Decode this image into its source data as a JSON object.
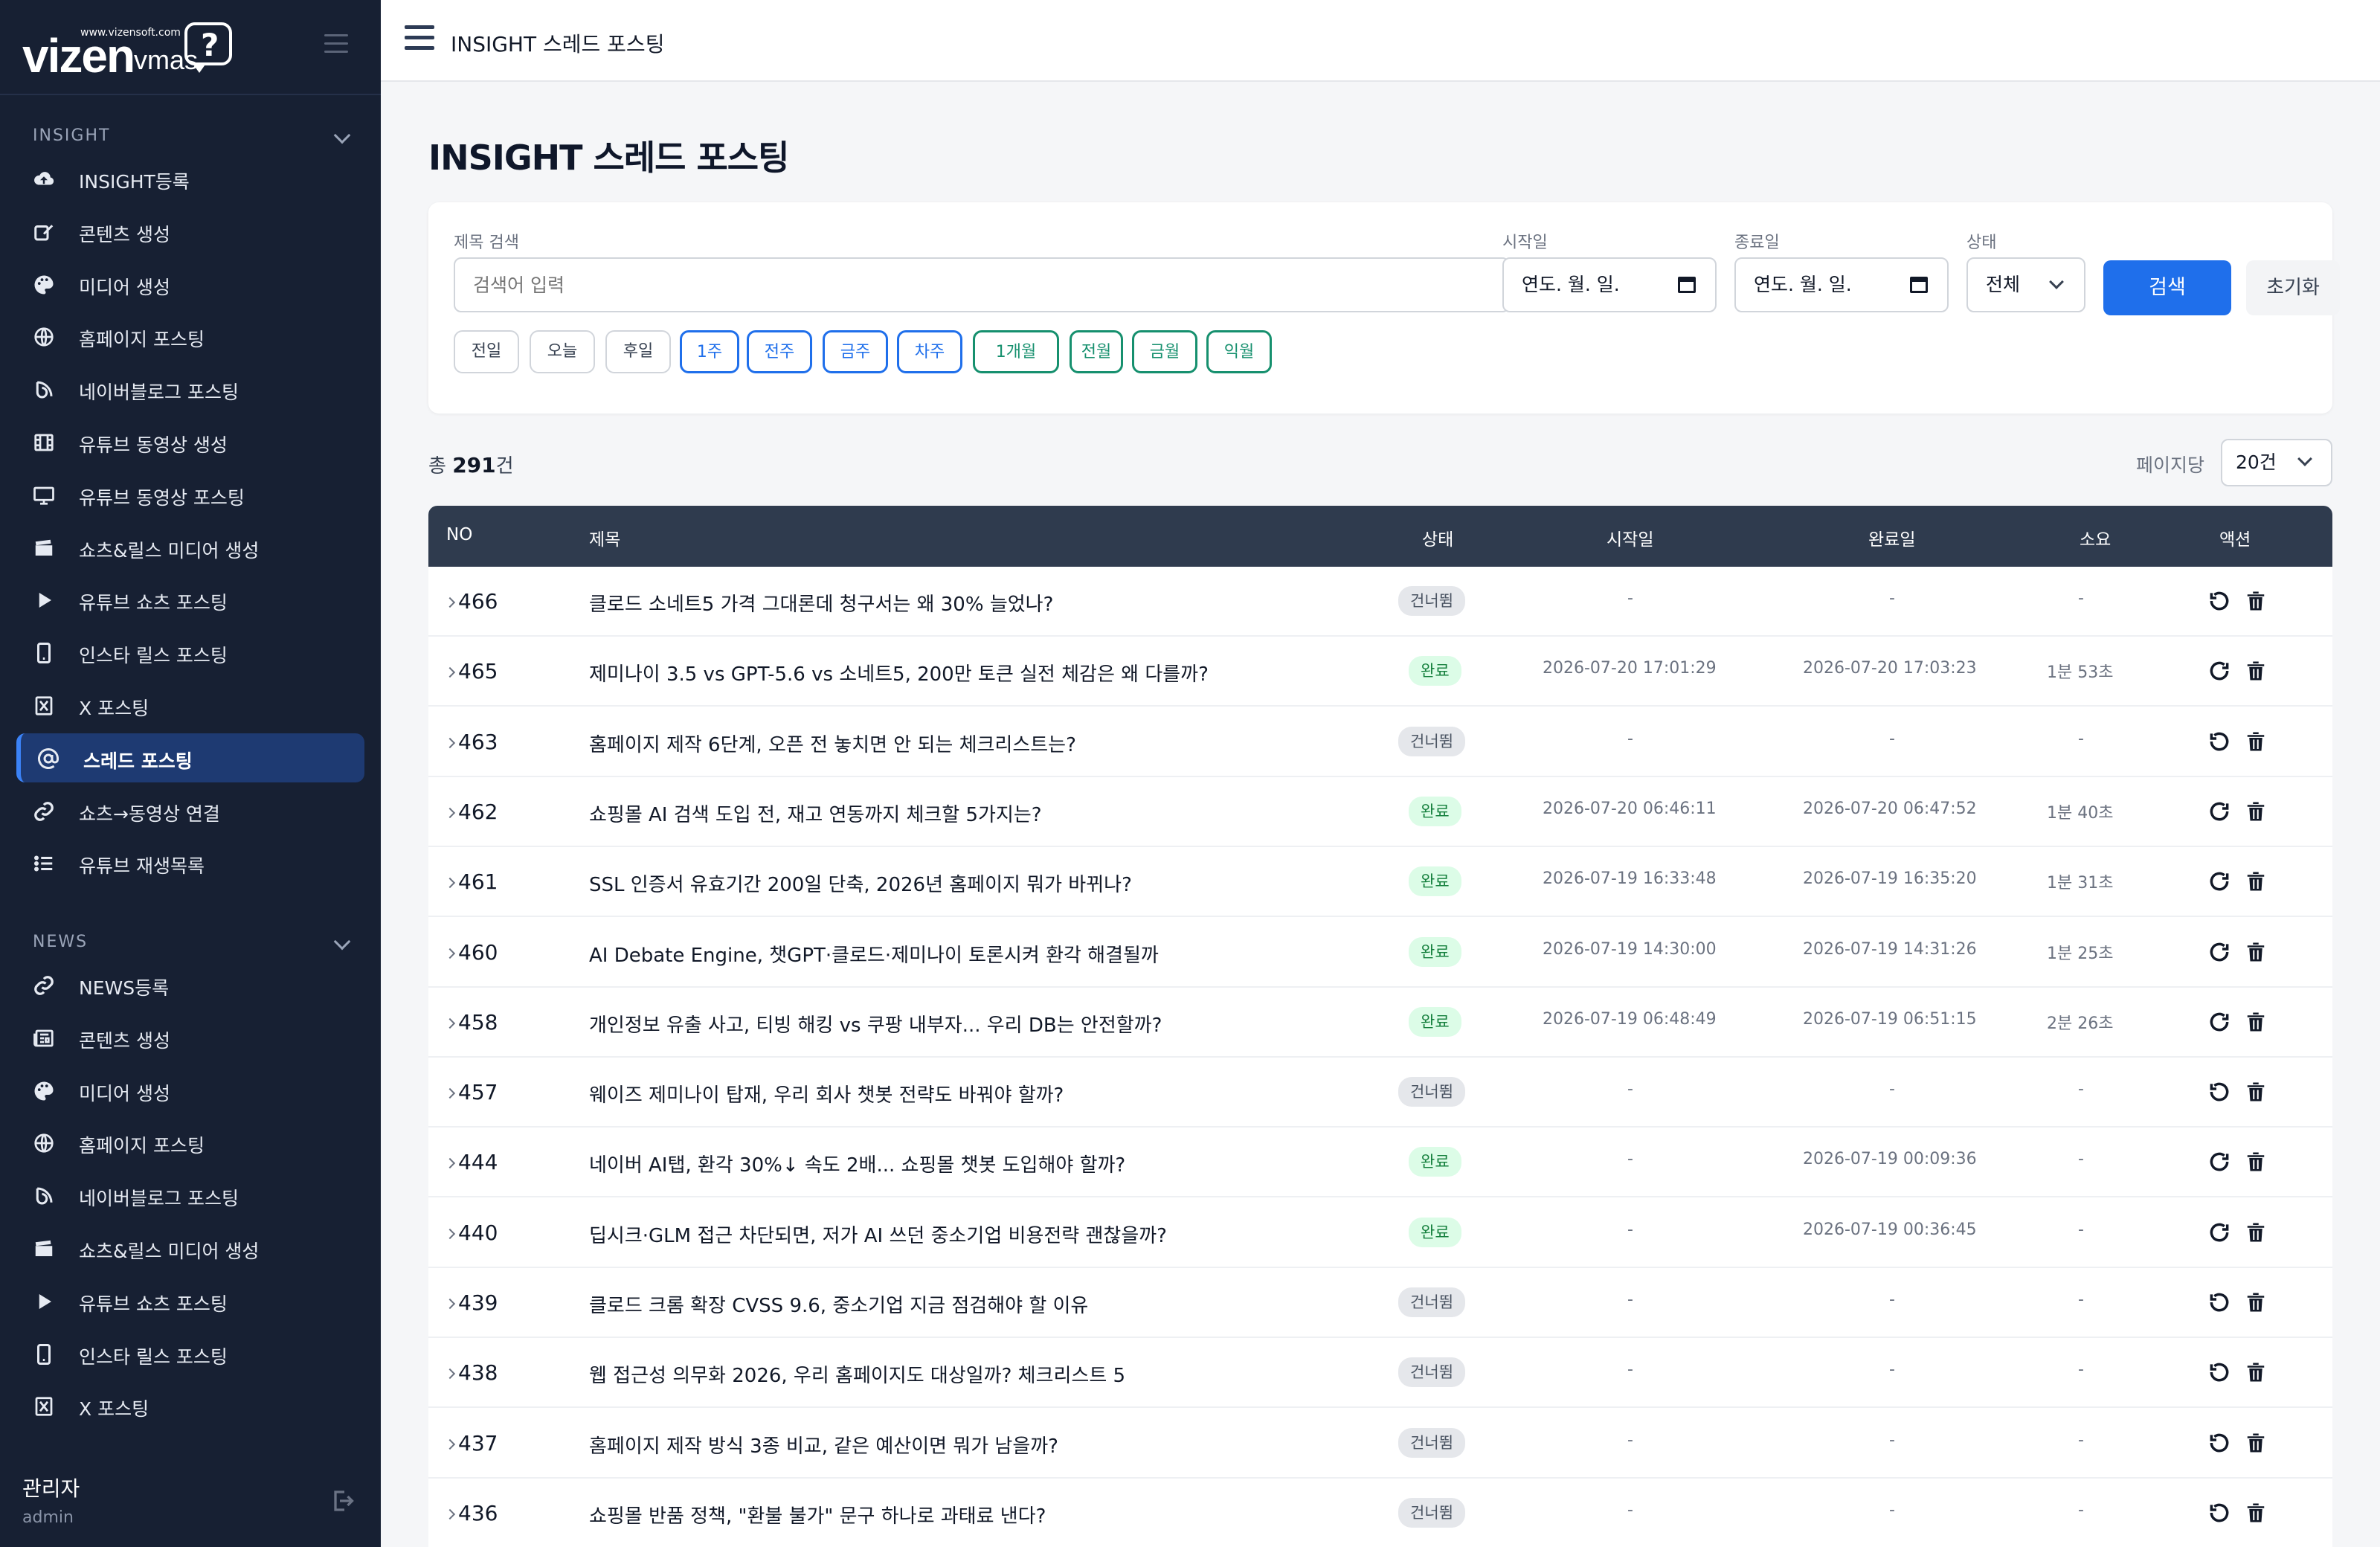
{
  "logo": {
    "url": "www.vizensoft.com",
    "vizen": "vizen",
    "vmas": "vmas",
    "bubble": "?"
  },
  "sidebar": {
    "sections": [
      {
        "title": "INSIGHT",
        "items": [
          {
            "label": "INSIGHT등록",
            "icon": "cloud-upload-icon"
          },
          {
            "label": "콘텐츠 생성",
            "icon": "edit-icon"
          },
          {
            "label": "미디어 생성",
            "icon": "palette-icon"
          },
          {
            "label": "홈페이지 포스팅",
            "icon": "globe-icon"
          },
          {
            "label": "네이버블로그 포스팅",
            "icon": "blog-icon"
          },
          {
            "label": "유튜브 동영상 생성",
            "icon": "film-icon"
          },
          {
            "label": "유튜브 동영상 포스팅",
            "icon": "monitor-icon"
          },
          {
            "label": "쇼츠&릴스 미디어 생성",
            "icon": "clapper-icon"
          },
          {
            "label": "유튜브 쇼츠 포스팅",
            "icon": "play-icon"
          },
          {
            "label": "인스타 릴스 포스팅",
            "icon": "phone-icon"
          },
          {
            "label": "X 포스팅",
            "icon": "x-icon"
          },
          {
            "label": "스레드 포스팅",
            "icon": "at-icon",
            "active": true
          },
          {
            "label": "쇼츠→동영상 연결",
            "icon": "link-icon"
          },
          {
            "label": "유튜브 재생목록",
            "icon": "list-icon"
          }
        ]
      },
      {
        "title": "NEWS",
        "items": [
          {
            "label": "NEWS등록",
            "icon": "link-icon"
          },
          {
            "label": "콘텐츠 생성",
            "icon": "newspaper-icon"
          },
          {
            "label": "미디어 생성",
            "icon": "palette-icon"
          },
          {
            "label": "홈페이지 포스팅",
            "icon": "globe-icon"
          },
          {
            "label": "네이버블로그 포스팅",
            "icon": "blog-icon"
          },
          {
            "label": "쇼츠&릴스 미디어 생성",
            "icon": "clapper-icon"
          },
          {
            "label": "유튜브 쇼츠 포스팅",
            "icon": "play-icon"
          },
          {
            "label": "인스타 릴스 포스팅",
            "icon": "phone-icon"
          },
          {
            "label": "X 포스팅",
            "icon": "x-icon"
          }
        ]
      }
    ],
    "user": {
      "name": "관리자",
      "id": "admin"
    }
  },
  "topbar": {
    "title": "INSIGHT 스레드 포스팅"
  },
  "page": {
    "title": "INSIGHT 스레드 포스팅"
  },
  "filter": {
    "title_label": "제목 검색",
    "title_placeholder": "검색어 입력",
    "start_label": "시작일",
    "start_value": "연도. 월. 일.",
    "end_label": "종료일",
    "end_value": "연도. 월. 일.",
    "status_label": "상태",
    "status_value": "전체",
    "search_btn": "검색",
    "reset_btn": "초기화",
    "quick": [
      {
        "label": "전일",
        "style": "gray"
      },
      {
        "label": "오늘",
        "style": "gray"
      },
      {
        "label": "후일",
        "style": "gray"
      },
      {
        "label": "1주",
        "style": "blue"
      },
      {
        "label": "전주",
        "style": "blue"
      },
      {
        "label": "금주",
        "style": "blue"
      },
      {
        "label": "차주",
        "style": "blue"
      },
      {
        "label": "1개월",
        "style": "green"
      },
      {
        "label": "전월",
        "style": "green"
      },
      {
        "label": "금월",
        "style": "green"
      },
      {
        "label": "익월",
        "style": "green"
      }
    ]
  },
  "summary": {
    "prefix": "총 ",
    "count": "291",
    "suffix": "건",
    "perpage_label": "페이지당",
    "perpage_value": "20건"
  },
  "table": {
    "headers": {
      "no": "NO",
      "title": "제목",
      "status": "상태",
      "start": "시작일",
      "end": "완료일",
      "duration": "소요",
      "action": "액션"
    },
    "rows": [
      {
        "no": "466",
        "title": "클로드 소네트5 가격 그대론데 청구서는 왜 30% 늘었나?",
        "status": "건너뜀",
        "start": "-",
        "end": "-",
        "duration": "-",
        "done": false
      },
      {
        "no": "465",
        "title": "제미나이 3.5 vs GPT-5.6 vs 소네트5, 200만 토큰 실전 체감은 왜 다를까?",
        "status": "완료",
        "start": "2026-07-20 17:01:29",
        "end": "2026-07-20 17:03:23",
        "duration": "1분 53초",
        "done": true
      },
      {
        "no": "463",
        "title": "홈페이지 제작 6단계, 오픈 전 놓치면 안 되는 체크리스트는?",
        "status": "건너뜀",
        "start": "-",
        "end": "-",
        "duration": "-",
        "done": false
      },
      {
        "no": "462",
        "title": "쇼핑몰 AI 검색 도입 전, 재고 연동까지 체크할 5가지는?",
        "status": "완료",
        "start": "2026-07-20 06:46:11",
        "end": "2026-07-20 06:47:52",
        "duration": "1분 40초",
        "done": true
      },
      {
        "no": "461",
        "title": "SSL 인증서 유효기간 200일 단축, 2026년 홈페이지 뭐가 바뀌나?",
        "status": "완료",
        "start": "2026-07-19 16:33:48",
        "end": "2026-07-19 16:35:20",
        "duration": "1분 31초",
        "done": true
      },
      {
        "no": "460",
        "title": "AI Debate Engine, 챗GPT·클로드·제미나이 토론시켜 환각 해결될까",
        "status": "완료",
        "start": "2026-07-19 14:30:00",
        "end": "2026-07-19 14:31:26",
        "duration": "1분 25초",
        "done": true
      },
      {
        "no": "458",
        "title": "개인정보 유출 사고, 티빙 해킹 vs 쿠팡 내부자... 우리 DB는 안전할까?",
        "status": "완료",
        "start": "2026-07-19 06:48:49",
        "end": "2026-07-19 06:51:15",
        "duration": "2분 26초",
        "done": true
      },
      {
        "no": "457",
        "title": "웨이즈 제미나이 탑재, 우리 회사 챗봇 전략도 바꿔야 할까?",
        "status": "건너뜀",
        "start": "-",
        "end": "-",
        "duration": "-",
        "done": false
      },
      {
        "no": "444",
        "title": "네이버 AI탭, 환각 30%↓ 속도 2배... 쇼핑몰 챗봇 도입해야 할까?",
        "status": "완료",
        "start": "-",
        "end": "2026-07-19 00:09:36",
        "duration": "-",
        "done": true
      },
      {
        "no": "440",
        "title": "딥시크·GLM 접근 차단되면, 저가 AI 쓰던 중소기업 비용전략 괜찮을까?",
        "status": "완료",
        "start": "-",
        "end": "2026-07-19 00:36:45",
        "duration": "-",
        "done": true
      },
      {
        "no": "439",
        "title": "클로드 크롬 확장 CVSS 9.6, 중소기업 지금 점검해야 할 이유",
        "status": "건너뜀",
        "start": "-",
        "end": "-",
        "duration": "-",
        "done": false
      },
      {
        "no": "438",
        "title": "웹 접근성 의무화 2026, 우리 홈페이지도 대상일까? 체크리스트 5",
        "status": "건너뜀",
        "start": "-",
        "end": "-",
        "duration": "-",
        "done": false
      },
      {
        "no": "437",
        "title": "홈페이지 제작 방식 3종 비교, 같은 예산이면 뭐가 남을까?",
        "status": "건너뜀",
        "start": "-",
        "end": "-",
        "duration": "-",
        "done": false
      },
      {
        "no": "436",
        "title": "쇼핑몰 반품 정책, \"환불 불가\" 문구 하나로 과태료 낸다?",
        "status": "건너뜀",
        "start": "-",
        "end": "-",
        "duration": "-",
        "done": false
      }
    ]
  },
  "colors": {
    "sidebar": "#172033",
    "accent": "#1f6feb",
    "green": "#16906e",
    "table_header": "#2f3b4e"
  }
}
